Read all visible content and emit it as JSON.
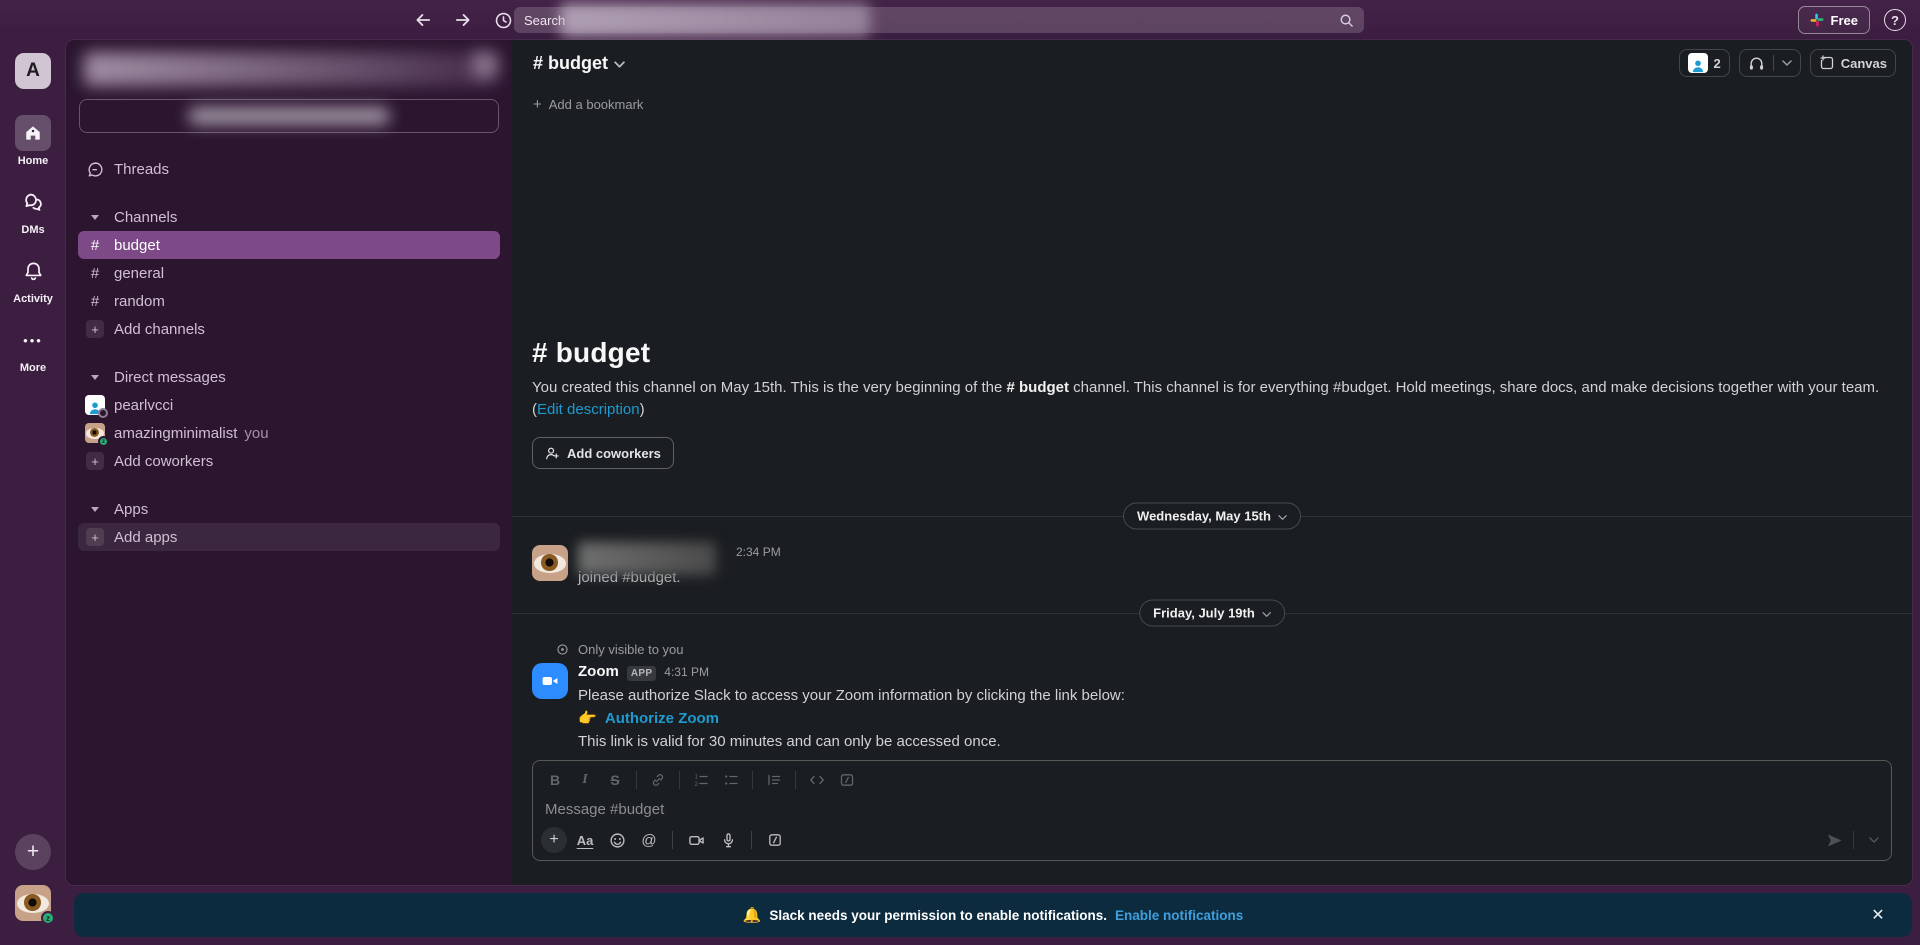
{
  "topbar": {
    "search_placeholder": "Search",
    "free_button": "Free"
  },
  "rail": {
    "workspace_initial": "A",
    "home_label": "Home",
    "dms_label": "DMs",
    "activity_label": "Activity",
    "more_label": "More"
  },
  "sidebar": {
    "threads": "Threads",
    "channels_header": "Channels",
    "channels": [
      {
        "label": "budget"
      },
      {
        "label": "general"
      },
      {
        "label": "random"
      }
    ],
    "add_channels": "Add channels",
    "dms_header": "Direct messages",
    "dm_items": [
      {
        "label": "pearlvcci"
      },
      {
        "label": "amazingminimalist",
        "suffix": "you"
      }
    ],
    "add_coworkers": "Add coworkers",
    "apps_header": "Apps",
    "add_apps": "Add apps"
  },
  "channel_header": {
    "title": "# budget",
    "member_count": "2",
    "canvas_label": "Canvas",
    "add_bookmark": "Add a bookmark"
  },
  "intro": {
    "title": "# budget",
    "body_1": "You created this channel on May 15th. This is the very beginning of the ",
    "body_channel": "# budget",
    "body_2": " channel. This channel is for everything #budget. Hold meetings, share docs, and make decisions together with your team. (",
    "edit_link": "Edit description",
    "body_3": ")",
    "add_coworkers_button": "Add coworkers"
  },
  "messages": {
    "date_divider_1": "Wednesday, May 15th",
    "joined": {
      "time": "2:34 PM",
      "text": "joined #budget."
    },
    "date_divider_2": "Friday, July 19th",
    "only_visible": "Only visible to you",
    "zoom_message": {
      "sender": "Zoom",
      "badge": "APP",
      "time": "4:31 PM",
      "line1": "Please authorize Slack to access your Zoom information by clicking the link below:",
      "pointer_emoji": "👉",
      "link": "Authorize Zoom",
      "line3": "This link is valid for 30 minutes and can only be accessed once."
    }
  },
  "composer": {
    "placeholder": "Message #budget"
  },
  "banner": {
    "bell_emoji": "🔔",
    "text": "Slack needs your permission to enable notifications.",
    "link": "Enable notifications"
  },
  "icons": {
    "plus": "+",
    "hash": "#",
    "dots": "•••",
    "close": "✕",
    "at": "@",
    "bold": "B",
    "italic": "I",
    "strike": "S",
    "aa": "Aa",
    "code": "</>",
    "question": "?",
    "z": "z"
  },
  "colors": {
    "topbar_purple": "#3c1e41",
    "sidebar_purple": "#2b152f",
    "selected_channel": "#7d4a87",
    "main_bg": "#1a1d21",
    "link_blue": "#1d9bd1",
    "banner_bg": "#0c2b3f",
    "zoom_blue": "#2d8cff",
    "presence_green": "#2bac76"
  }
}
